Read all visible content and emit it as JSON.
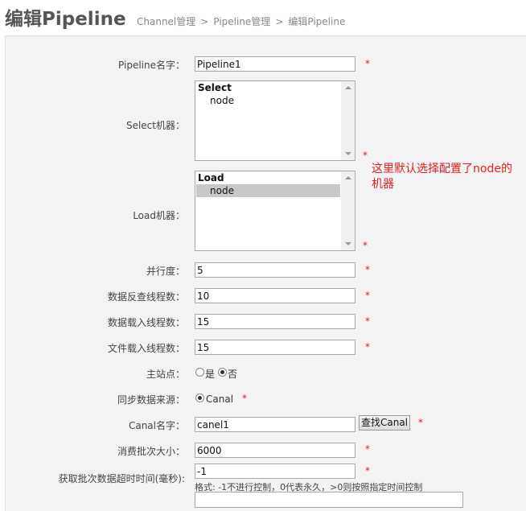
{
  "header": {
    "title": "编辑Pipeline",
    "breadcrumb": [
      "Channel管理",
      "Pipeline管理",
      "编辑Pipeline"
    ],
    "breadcrumb_separator": ">"
  },
  "form": {
    "pipeline_name": {
      "label": "Pipeline名字：",
      "value": "Pipeline1",
      "required": "*"
    },
    "select_machine": {
      "label": "Select机器：",
      "group": "Select",
      "options": [
        "node"
      ],
      "selected": false,
      "required": "*"
    },
    "load_machine": {
      "label": "Load机器：",
      "group": "Load",
      "options": [
        "node"
      ],
      "selected": true,
      "required": "*"
    },
    "parallelism": {
      "label": "并行度：",
      "value": "5",
      "required": "*"
    },
    "extract_threads": {
      "label": "数据反查线程数：",
      "value": "10",
      "required": "*"
    },
    "load_threads": {
      "label": "数据载入线程数：",
      "value": "15",
      "required": "*"
    },
    "file_load_threads": {
      "label": "文件载入线程数：",
      "value": "15",
      "required": "*"
    },
    "main_station": {
      "label": "主站点：",
      "options": [
        "是",
        "否"
      ],
      "selected": "否"
    },
    "sync_source": {
      "label": "同步数据来源：",
      "options": [
        "Canal"
      ],
      "selected": "Canal",
      "required": "*"
    },
    "canal_name": {
      "label": "Canal名字：",
      "value": "canel1",
      "button": "查找Canal",
      "required": "*"
    },
    "batch_size": {
      "label": "消费批次大小：",
      "value": "6000",
      "required": "*"
    },
    "batch_timeout": {
      "label": "获取批次数据超时时间(毫秒):",
      "value": "-1",
      "required": "*",
      "hint": "格式: -1不进行控制，0代表永久，>0则按照指定时间控制"
    }
  },
  "annotation": {
    "text": "这里默认选择配置了node的机器",
    "color": "#e02020"
  },
  "colors": {
    "panel_bg": "#f3f3f3",
    "required": "#e02020",
    "selected_option": "#c8c8c8"
  }
}
